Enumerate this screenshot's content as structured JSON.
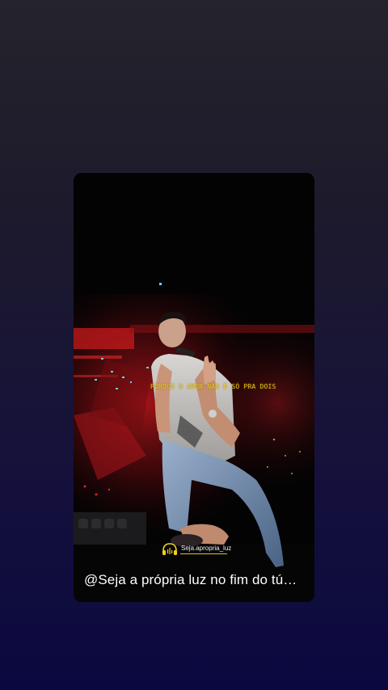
{
  "colors": {
    "background_top": "#25232b",
    "background_bottom": "#0b0840",
    "lyric_accent": "#f2d21c",
    "stage_red": "#c8191c"
  },
  "video": {
    "lyrics_text": "PORQUE O AMOR NÃO É SÓ PRA DOIS",
    "watermark_text": "Seja.apropria_luz",
    "watermark_icon": "headphones-icon",
    "caption": "@Seja a própria luz no fim do tú…"
  }
}
